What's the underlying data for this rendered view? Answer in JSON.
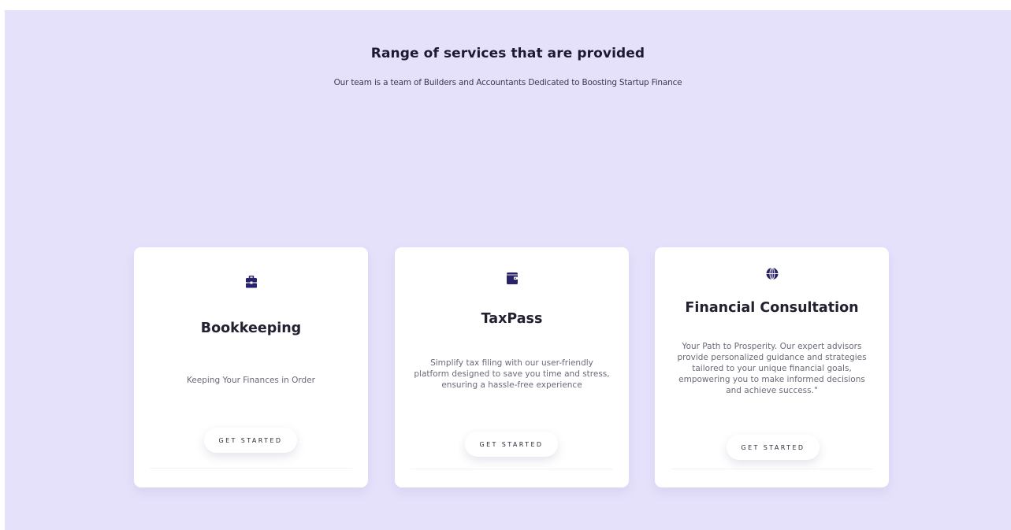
{
  "section": {
    "title": "Range of services that are provided",
    "subtitle": "Our team is a team of Builders and Accountants Dedicated to Boosting Startup Finance"
  },
  "colors": {
    "background": "#e6e1fb",
    "card": "#ffffff",
    "icon": "#2a2268"
  },
  "cards": [
    {
      "icon": "briefcase-icon",
      "title": "Bookkeeping",
      "description": "Keeping Your Finances in Order",
      "button": "GET STARTED"
    },
    {
      "icon": "wallet-icon",
      "title": "TaxPass",
      "description": "Simplify tax filing with our user-friendly platform designed to save you time and stress, ensuring a hassle-free experience",
      "button": "GET STARTED"
    },
    {
      "icon": "globe-icon",
      "title": "Financial Consultation",
      "description": "Your Path to Prosperity. Our expert advisors provide personalized guidance and strategies tailored to your unique financial goals, empowering you to make informed decisions and achieve success.\"",
      "button": "GET STARTED"
    }
  ]
}
